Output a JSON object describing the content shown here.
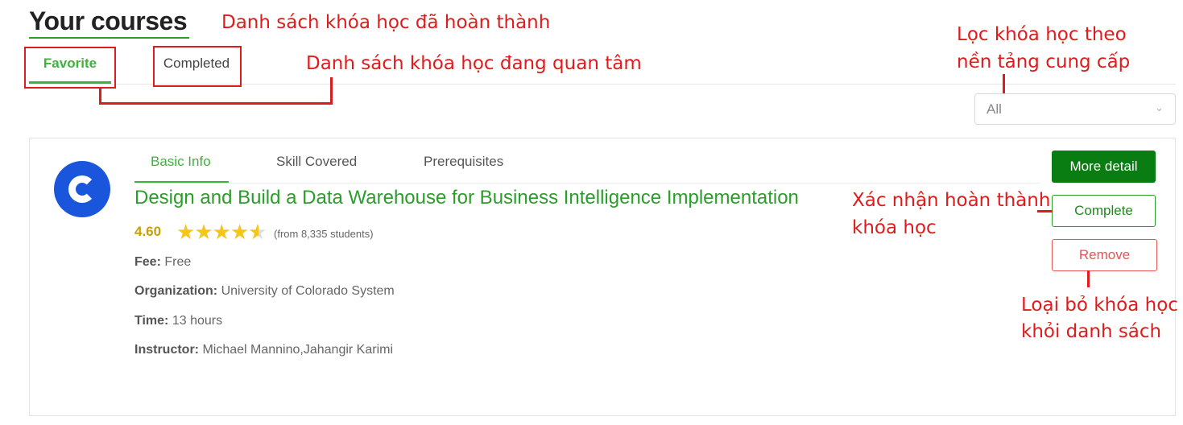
{
  "page": {
    "title": "Your courses",
    "tabs": [
      "Favorite",
      "Completed"
    ]
  },
  "filter": {
    "value": "All",
    "chevron_icon": "chevron-down-icon"
  },
  "course": {
    "logo_icon": "coursera-logo",
    "inner_tabs": [
      "Basic Info",
      "Skill Covered",
      "Prerequisites"
    ],
    "title": "Design and Build a Data Warehouse for Business Intelligence Implementation",
    "rating": "4.60",
    "rating_stars": 4.6,
    "rating_count": "(from 8,335 students)",
    "fee_label": "Fee:",
    "fee_value": "Free",
    "organization_label": "Organization:",
    "organization_value": "University of Colorado System",
    "time_label": "Time:",
    "time_value": "13 hours",
    "instructor_label": "Instructor:",
    "instructor_value": "Michael Mannino,Jahangir Karimi"
  },
  "buttons": {
    "more_detail": "More detail",
    "complete": "Complete",
    "remove": "Remove"
  },
  "annotations": {
    "completed_list": "Danh sách khóa học đã hoàn thành",
    "favorite_list": "Danh sách khóa học đang quan tâm",
    "filter_line1": "Lọc khóa học theo",
    "filter_line2": "nền tảng cung cấp",
    "confirm_line1": "Xác nhận hoàn thành",
    "confirm_line2": "khóa học",
    "remove_line1": "Loại bỏ khóa học",
    "remove_line2": "khỏi danh sách"
  },
  "colors": {
    "accent_green": "#3cb43c",
    "primary_button": "#0a7d12",
    "remove_red": "#e85454",
    "annotation_red": "#dd1c1c",
    "star_yellow": "#f5c518",
    "logo_blue": "#1a56db"
  }
}
